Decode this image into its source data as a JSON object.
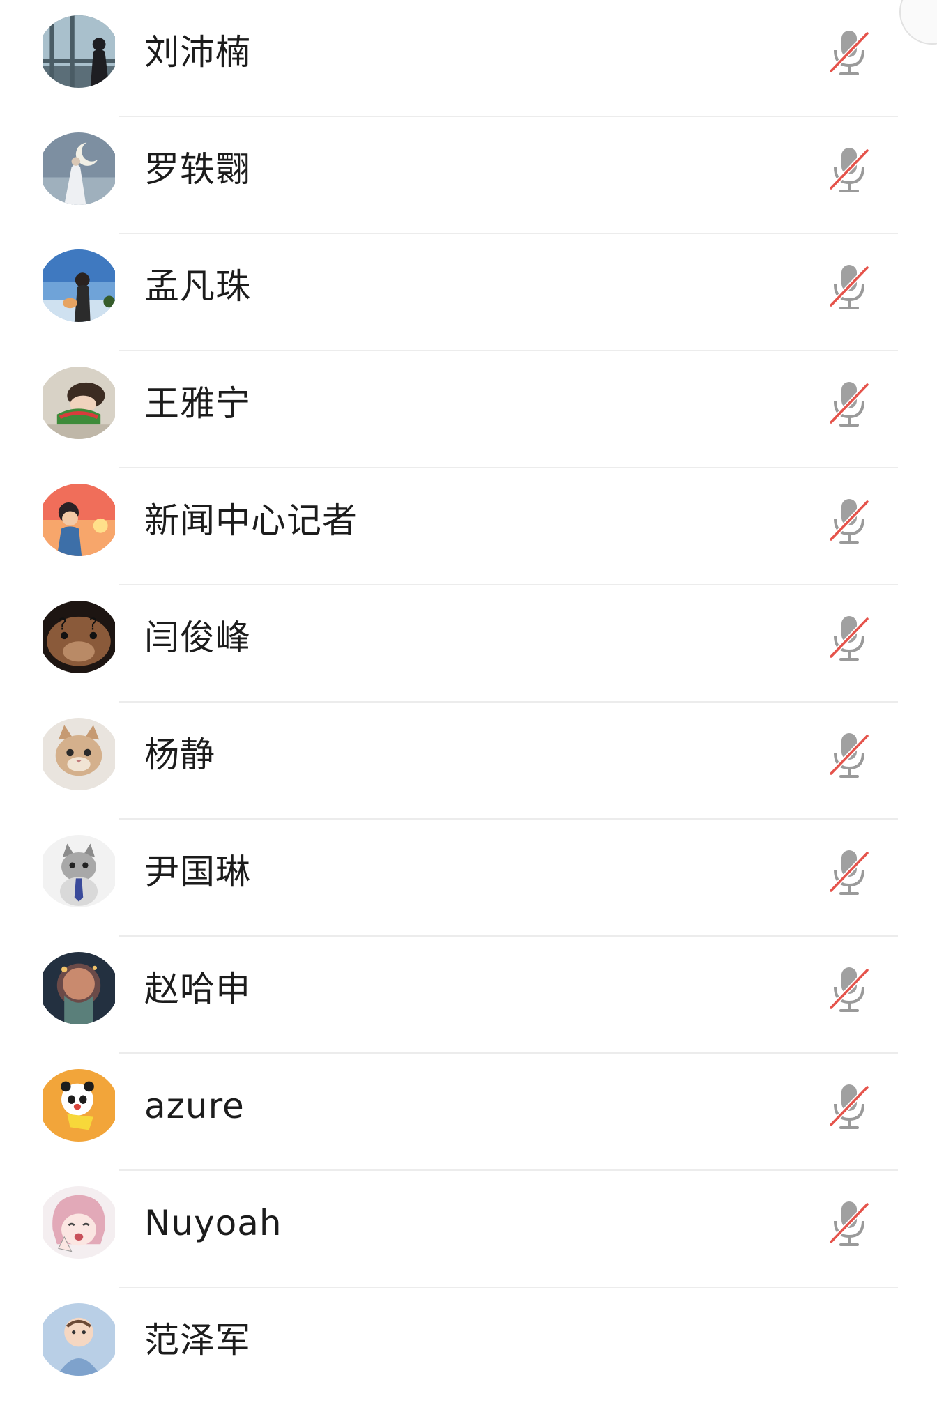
{
  "participants": [
    {
      "name": "刘沛楠",
      "avatar": "avatar-window-girl",
      "mic": "mic-off-icon"
    },
    {
      "name": "罗轶翾",
      "avatar": "avatar-moon-girl",
      "mic": "mic-off-icon"
    },
    {
      "name": "孟凡珠",
      "avatar": "avatar-sky-girl-dog",
      "mic": "mic-off-icon"
    },
    {
      "name": "王雅宁",
      "avatar": "avatar-sleeping-child",
      "mic": "mic-off-icon"
    },
    {
      "name": "新闻中心记者",
      "avatar": "avatar-sunset-boy",
      "mic": "mic-off-icon"
    },
    {
      "name": "闫俊峰",
      "avatar": "avatar-confused-hamster",
      "mic": "mic-off-icon"
    },
    {
      "name": "杨静",
      "avatar": "avatar-cat",
      "mic": "mic-off-icon"
    },
    {
      "name": "尹国琳",
      "avatar": "avatar-cat-tie",
      "mic": "mic-off-icon"
    },
    {
      "name": "赵哈申",
      "avatar": "avatar-dark-jellyfish",
      "mic": "mic-off-icon"
    },
    {
      "name": "azure",
      "avatar": "avatar-panda-sticker",
      "mic": "mic-off-icon"
    },
    {
      "name": "Nuyoah",
      "avatar": "avatar-anime-girl",
      "mic": "mic-off-icon"
    },
    {
      "name": "范泽军",
      "avatar": "avatar-baby",
      "mic": "none"
    }
  ],
  "colors": {
    "name_text": "#1c1c1c",
    "divider": "#ececec",
    "mic_body": "#9a9a9a",
    "mic_slash": "#e5534b"
  }
}
